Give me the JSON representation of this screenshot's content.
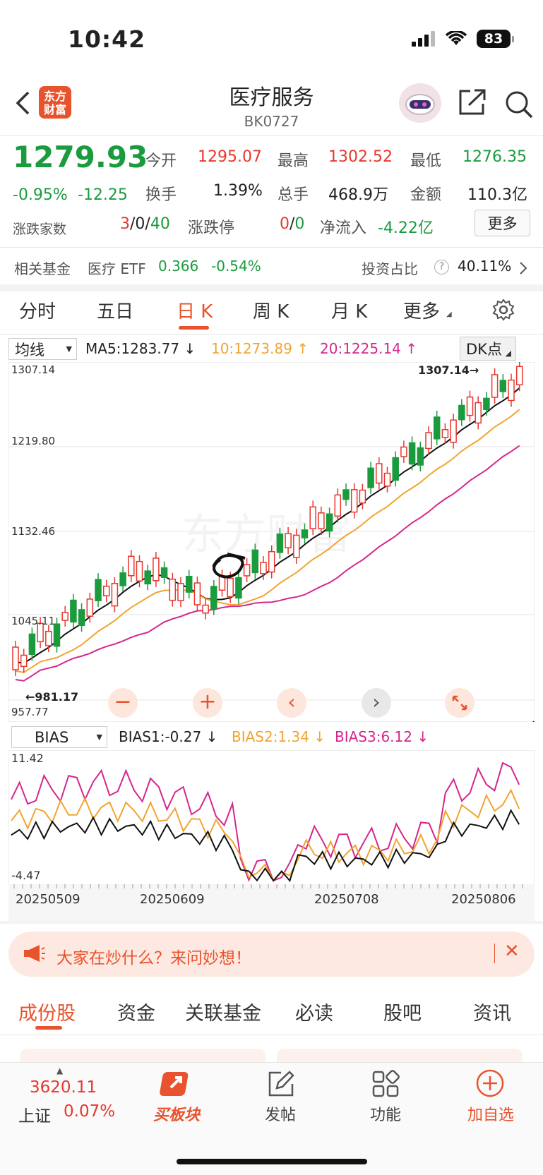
{
  "status": {
    "time": "10:42",
    "battery": "83"
  },
  "header": {
    "logo_line1": "东方",
    "logo_line2": "财富",
    "title": "医疗服务",
    "code": "BK0727"
  },
  "quote": {
    "price": "1279.93",
    "change_pct": "-0.95%",
    "change": "-12.25",
    "open_label": "今开",
    "open": "1295.07",
    "high_label": "最高",
    "high": "1302.52",
    "low_label": "最低",
    "low": "1276.35",
    "turnover_label": "换手",
    "turnover": "1.39%",
    "volume_label": "总手",
    "volume": "468.9万",
    "amount_label": "金额",
    "amount": "110.3亿",
    "breadth_label": "涨跌家数",
    "breadth_up": "3",
    "breadth_flat": "0",
    "breadth_down": "40",
    "limit_label": "涨跌停",
    "limit_up": "0",
    "limit_down": "0",
    "netflow_label": "净流入",
    "netflow": "-4.22亿",
    "more_label": "更多"
  },
  "fund": {
    "label": "相关基金",
    "name": "医疗 ETF",
    "price": "0.366",
    "change": "-0.54%",
    "ratio_label": "投资占比",
    "ratio": "40.11%"
  },
  "tabs": [
    "分时",
    "五日",
    "日 K",
    "周 K",
    "月 K",
    "更多"
  ],
  "kline": {
    "ma_select": "均线",
    "ma5": "MA5:1283.77",
    "ma10": "10:1273.89",
    "ma20": "20:1225.14",
    "dk_select": "DK点",
    "y_labels": [
      "1307.14",
      "1219.80",
      "1132.46",
      "1045.11",
      "957.77"
    ],
    "max_label": "1307.14",
    "min_label": "981.17"
  },
  "bias": {
    "select": "BIAS",
    "bias1": "BIAS1:-0.27",
    "bias2": "BIAS2:1.34",
    "bias3": "BIAS3:6.12",
    "y_max": "11.42",
    "y_min": "-4.47",
    "dates": [
      "20250509",
      "20250609",
      "20250708",
      "20250806"
    ]
  },
  "notice": {
    "text": "大家在炒什么？来问妙想！"
  },
  "bottom_tabs": [
    "成份股",
    "资金",
    "关联基金",
    "必读",
    "股吧",
    "资讯"
  ],
  "bottom_nav": {
    "index_value": "3620.11",
    "index_name": "上证",
    "index_change": "0.07%",
    "items": [
      "买板块",
      "发帖",
      "功能",
      "加自选"
    ]
  },
  "colors": {
    "up": "#e8372d",
    "down": "#1a9b3d",
    "accent": "#e8532d",
    "ma10": "#f0a530",
    "ma20": "#d6268c"
  }
}
